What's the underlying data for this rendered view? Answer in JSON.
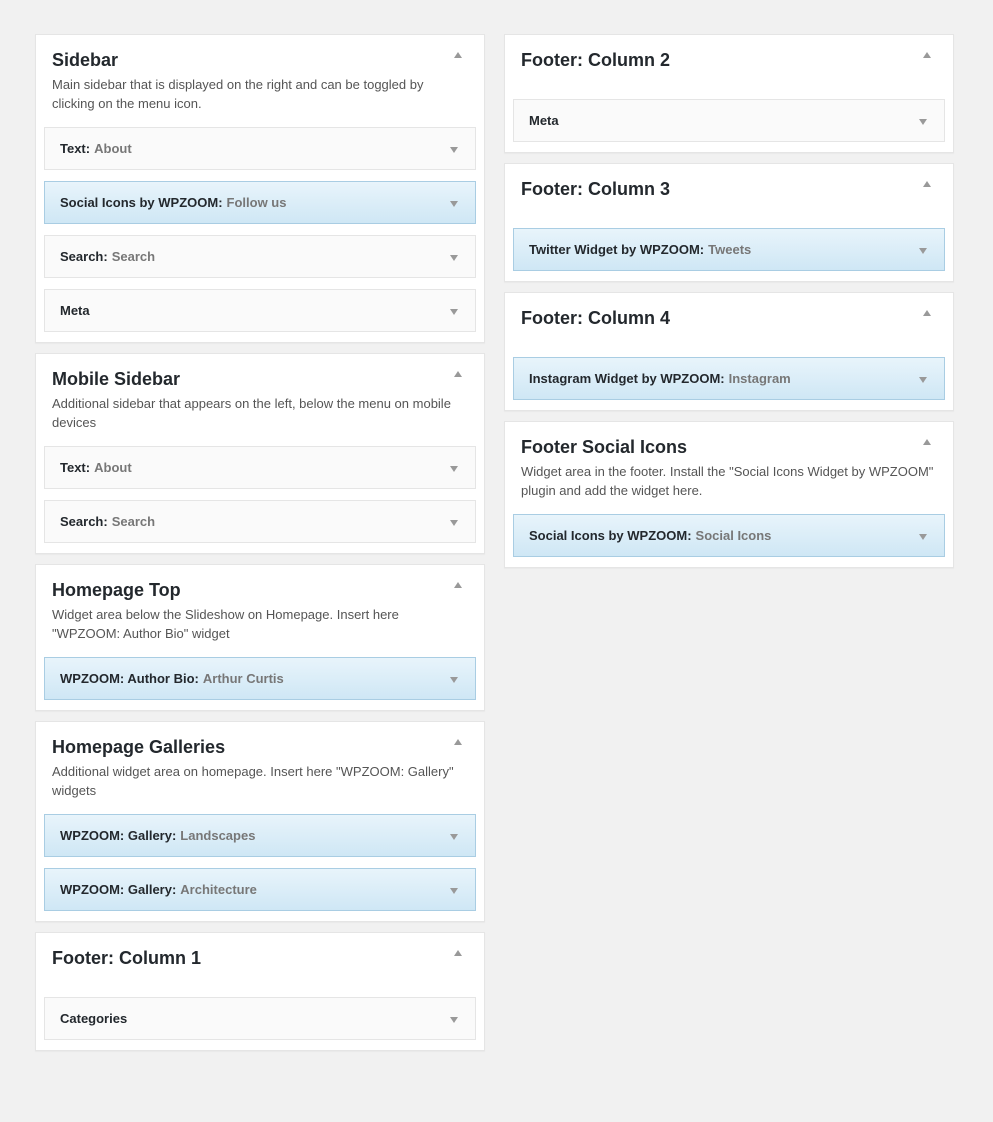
{
  "left": [
    {
      "title": "Sidebar",
      "description": "Main sidebar that is displayed on the right and can be toggled by clicking on the menu icon.",
      "widgets": [
        {
          "type": "Text:",
          "name": "About",
          "highlight": false
        },
        {
          "type": "Social Icons by WPZOOM:",
          "name": "Follow us",
          "highlight": true
        },
        {
          "type": "Search:",
          "name": "Search",
          "highlight": false
        },
        {
          "type": "Meta",
          "name": "",
          "highlight": false
        }
      ]
    },
    {
      "title": "Mobile Sidebar",
      "description": "Additional sidebar that appears on the left, below the menu on mobile devices",
      "widgets": [
        {
          "type": "Text:",
          "name": "About",
          "highlight": false
        },
        {
          "type": "Search:",
          "name": "Search",
          "highlight": false
        }
      ]
    },
    {
      "title": "Homepage Top",
      "description": "Widget area below the Slideshow on Homepage. Insert here \"WPZOOM: Author Bio\" widget",
      "widgets": [
        {
          "type": "WPZOOM: Author Bio:",
          "name": "Arthur Curtis",
          "highlight": true
        }
      ]
    },
    {
      "title": "Homepage Galleries",
      "description": "Additional widget area on homepage. Insert here \"WPZOOM: Gallery\" widgets",
      "widgets": [
        {
          "type": "WPZOOM: Gallery:",
          "name": "Landscapes",
          "highlight": true
        },
        {
          "type": "WPZOOM: Gallery:",
          "name": "Architecture",
          "highlight": true
        }
      ]
    },
    {
      "title": "Footer: Column 1",
      "description": "",
      "widgets": [
        {
          "type": "Categories",
          "name": "",
          "highlight": false
        }
      ]
    }
  ],
  "right": [
    {
      "title": "Footer: Column 2",
      "description": "",
      "widgets": [
        {
          "type": "Meta",
          "name": "",
          "highlight": false
        }
      ]
    },
    {
      "title": "Footer: Column 3",
      "description": "",
      "widgets": [
        {
          "type": "Twitter Widget by WPZOOM:",
          "name": "Tweets",
          "highlight": true
        }
      ]
    },
    {
      "title": "Footer: Column 4",
      "description": "",
      "widgets": [
        {
          "type": "Instagram Widget by WPZOOM:",
          "name": "Instagram",
          "highlight": true
        }
      ]
    },
    {
      "title": "Footer Social Icons",
      "description": "Widget area in the footer. Install the \"Social Icons Widget by WPZOOM\" plugin and add the widget here.",
      "widgets": [
        {
          "type": "Social Icons by WPZOOM:",
          "name": "Social Icons",
          "highlight": true
        }
      ]
    }
  ],
  "icons": {
    "area_toggle": "caret-up-icon",
    "widget_toggle": "caret-down-icon"
  }
}
